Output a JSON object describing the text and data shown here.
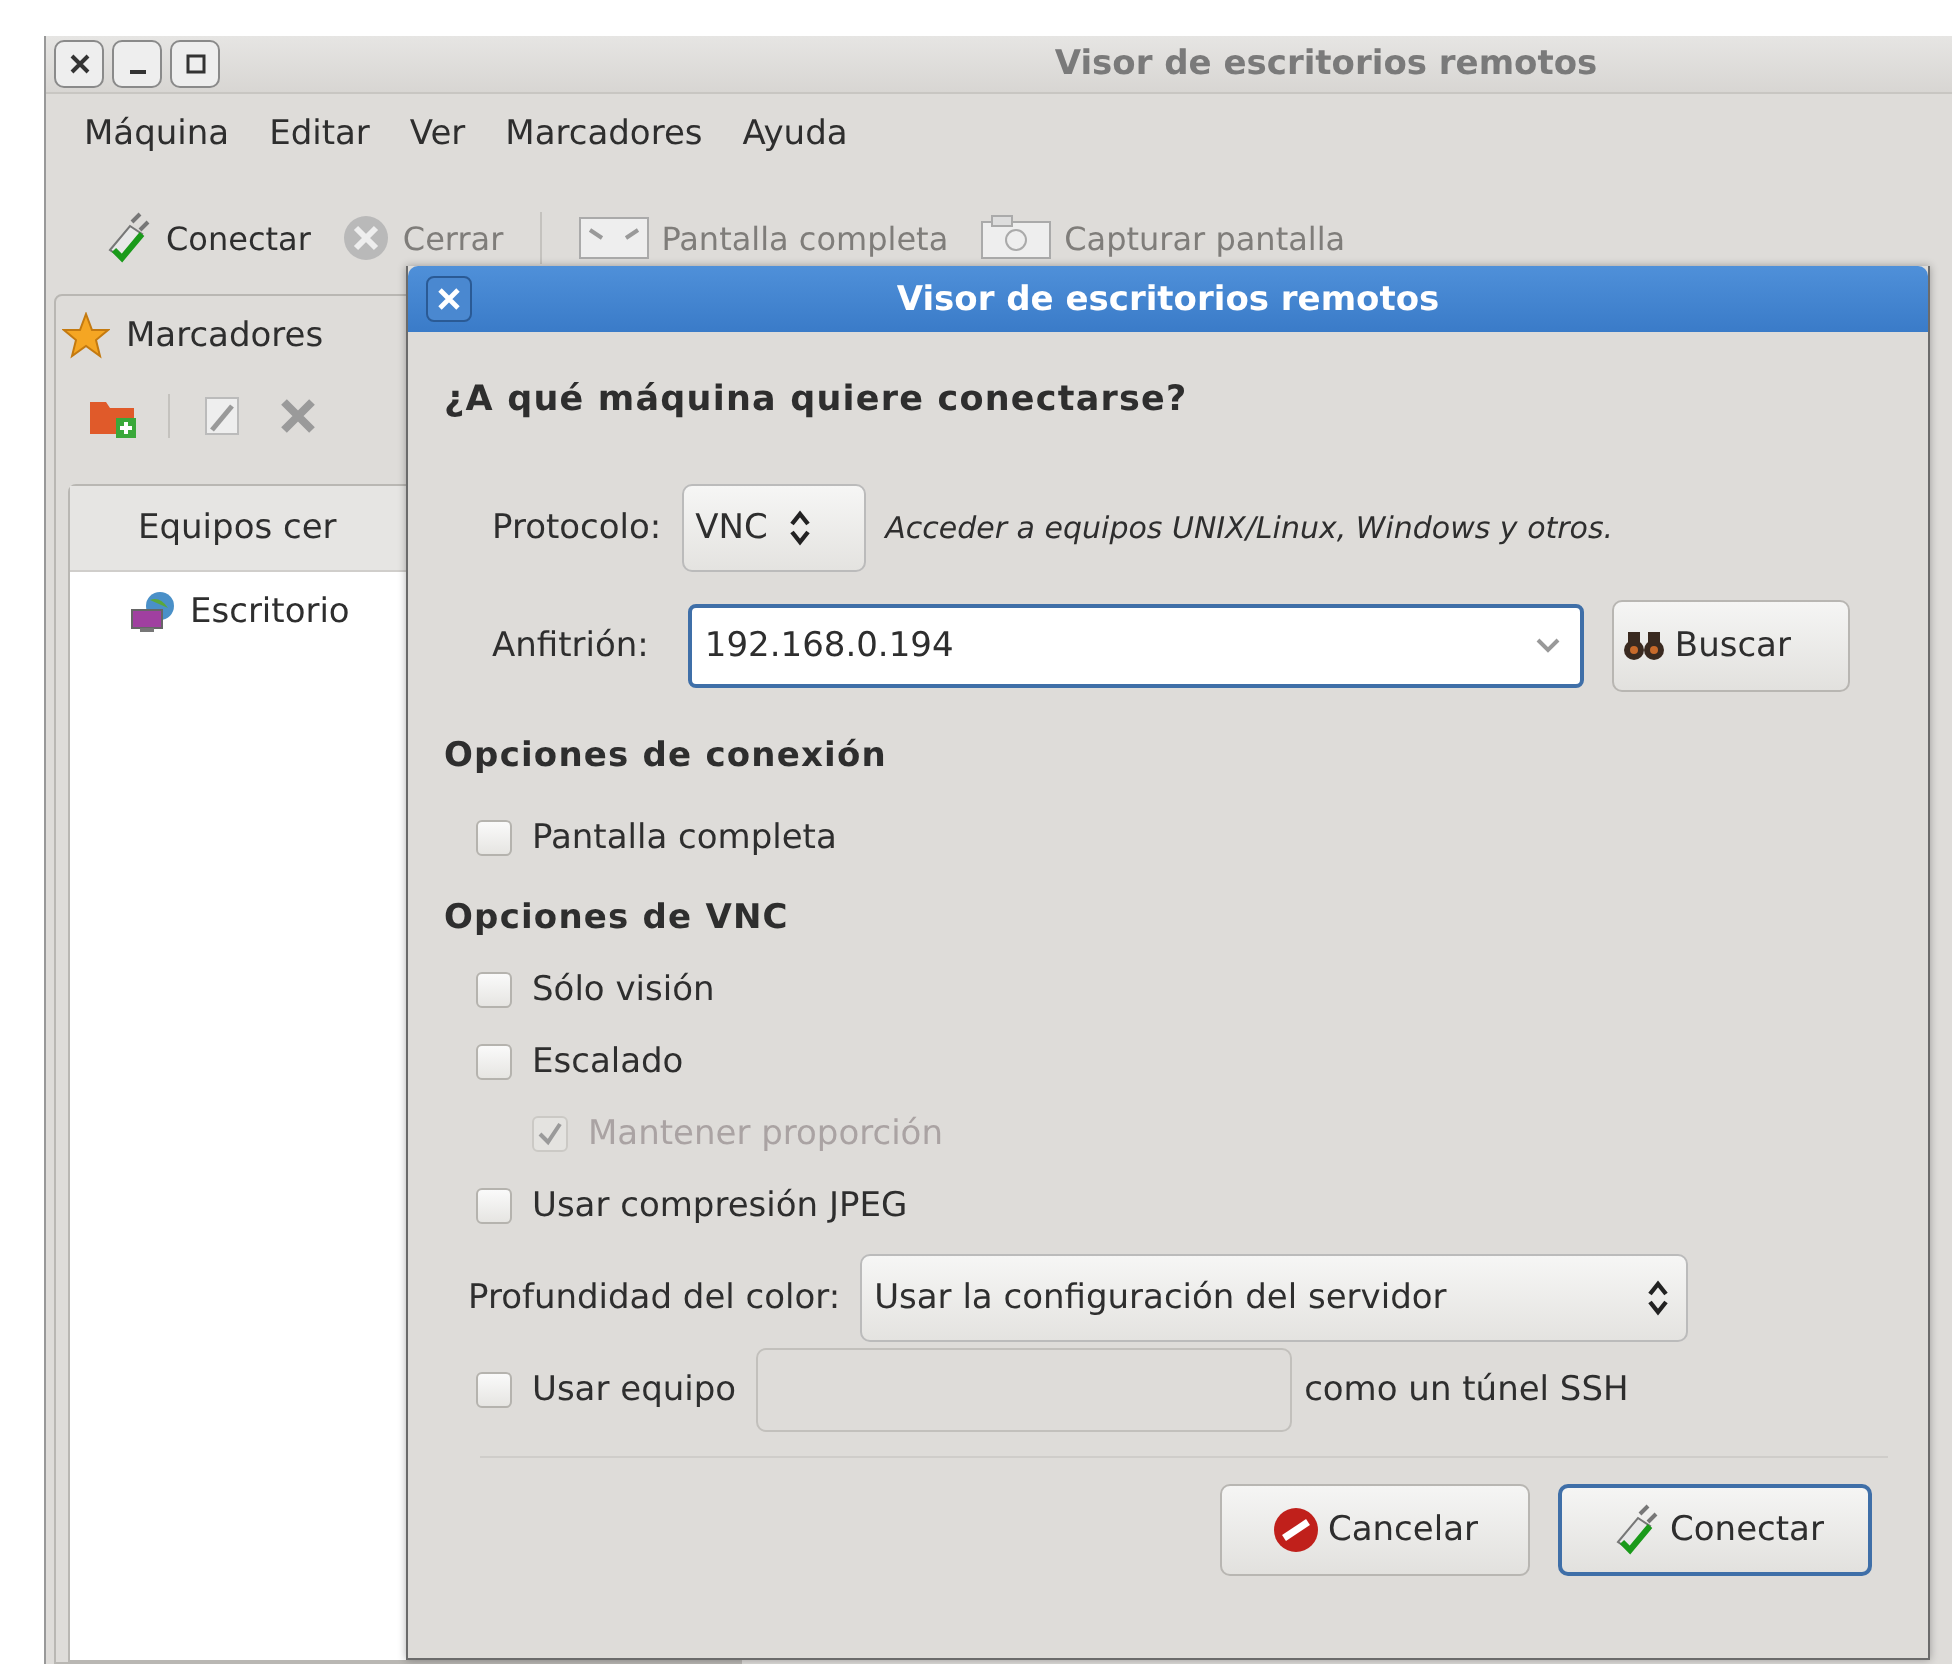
{
  "window": {
    "title": "Visor de escritorios remotos"
  },
  "menu": [
    "Máquina",
    "Editar",
    "Ver",
    "Marcadores",
    "Ayuda"
  ],
  "toolbar": [
    {
      "kind": "connect",
      "label": "Conectar",
      "disabled": false
    },
    {
      "kind": "close",
      "label": "Cerrar",
      "disabled": true
    },
    {
      "kind": "fullscreen",
      "label": "Pantalla completa",
      "disabled": true
    },
    {
      "kind": "screenshot",
      "label": "Capturar pantalla",
      "disabled": true
    }
  ],
  "sidebar": {
    "title": "Marcadores",
    "column": "Equipos cer",
    "items": [
      "Escritorio"
    ]
  },
  "dialog": {
    "title": "Visor de escritorios remotos",
    "heading": "¿A qué máquina quiere conectarse?",
    "protocol": {
      "label": "Protocolo:",
      "value": "VNC",
      "description": "Acceder a equipos UNIX/Linux, Windows y otros."
    },
    "host": {
      "label": "Anfitrión:",
      "value": "192.168.0.194",
      "button": "Buscar"
    },
    "sections": [
      {
        "title": "Opciones de conexión",
        "options": [
          {
            "kind": "check",
            "label": "Pantalla completa",
            "checked": false,
            "disabled": false
          }
        ]
      },
      {
        "title": "Opciones de VNC",
        "options": [
          {
            "kind": "check",
            "label": "Sólo visión",
            "checked": false,
            "disabled": false
          },
          {
            "kind": "check",
            "label": "Escalado",
            "checked": false,
            "disabled": false,
            "children": [
              {
                "kind": "check",
                "label": "Mantener proporción",
                "checked": true,
                "disabled": true
              }
            ]
          },
          {
            "kind": "check",
            "label": "Usar compresión JPEG",
            "checked": false,
            "disabled": false
          },
          {
            "kind": "select",
            "label": "Profundidad del color:",
            "value": "Usar la configuración del servidor"
          },
          {
            "kind": "tunnel",
            "label": "Usar equipo",
            "checked": false,
            "suffix": "como un túnel SSH"
          }
        ]
      }
    ],
    "buttons": [
      {
        "kind": "cancel",
        "label": "Cancelar",
        "default": false
      },
      {
        "kind": "connect",
        "label": "Conectar",
        "default": true
      }
    ]
  }
}
